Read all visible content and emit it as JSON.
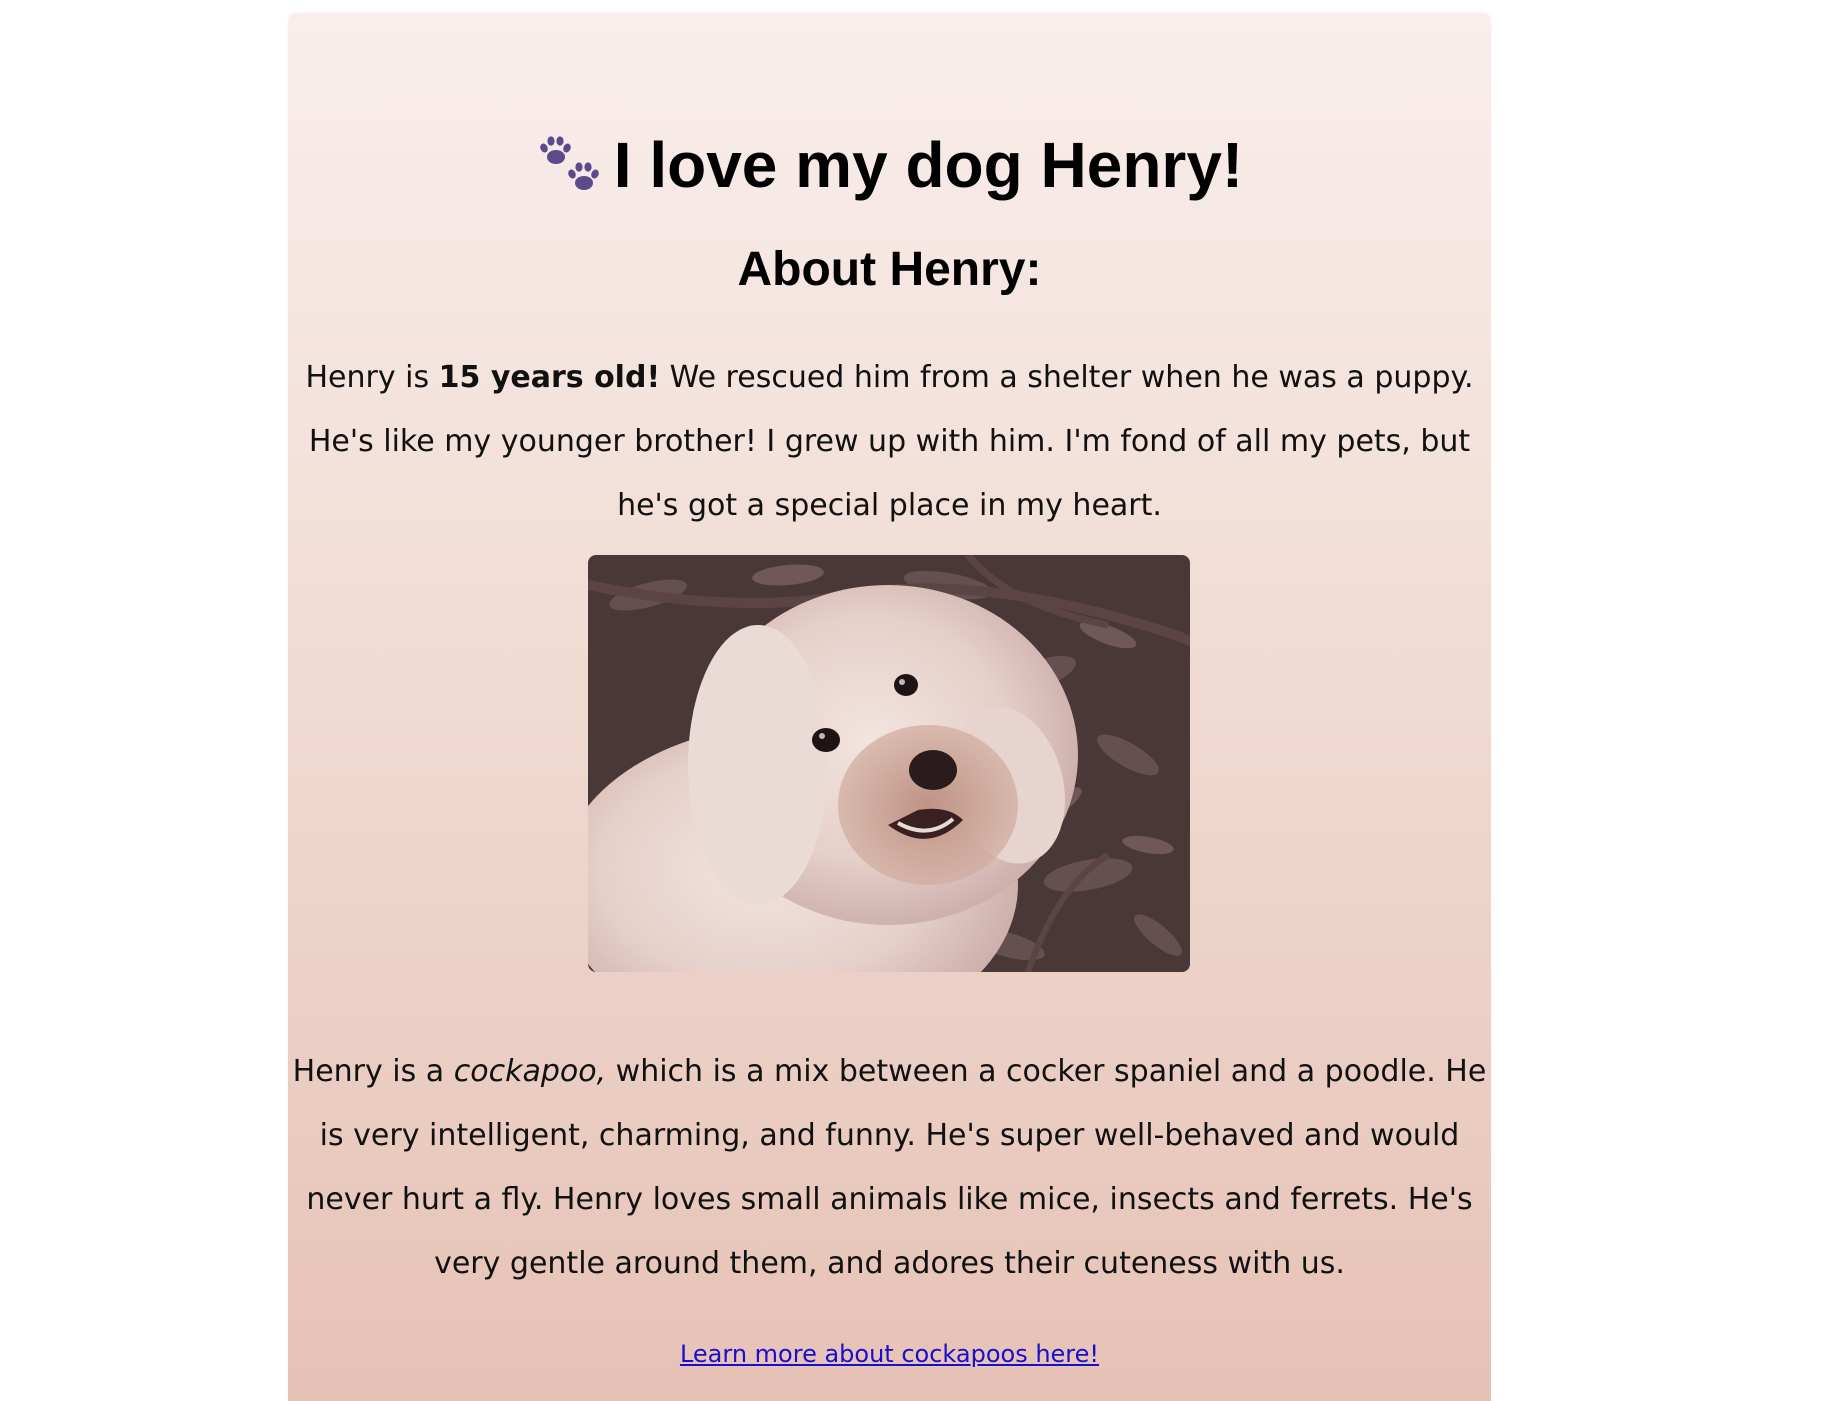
{
  "page": {
    "title": "I love my dog Henry!",
    "subtitle": "About Henry:"
  },
  "intro": {
    "before": "Henry is ",
    "bold": "15 years old!",
    "after": " We rescued him from a shelter when he was a puppy. He's like my younger brother! I grew up with him. I'm fond of all my pets, but he's got a special place in my heart."
  },
  "photo": {
    "alt": "Henry"
  },
  "description": {
    "before": "Henry is a ",
    "italic": "cockapoo,",
    "after": " which is a mix between a cocker spaniel and a poodle. He is very intelligent, charming, and funny. He's super well-behaved and would never hurt a fly. Henry loves small animals like mice, insects and ferrets. He's very gentle around them, and adores their cuteness with us."
  },
  "link": {
    "label": "Learn more about cockapoos here!"
  },
  "colors": {
    "paw": "#5b4b8a",
    "link": "#1a0dcc",
    "gradient_top": "#f9eeec",
    "gradient_bottom": "#e6c2b5"
  },
  "icons": {
    "heading_icon": "paw-prints-icon"
  }
}
